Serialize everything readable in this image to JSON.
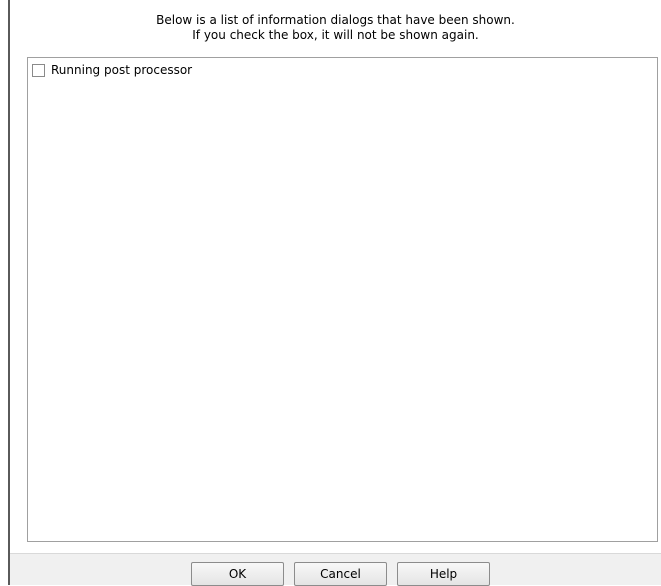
{
  "dialog": {
    "instructions": {
      "line1": "Below is a list of information dialogs that have been shown.",
      "line2": "If you check the box, it will not be shown again."
    },
    "list_items": [
      {
        "label": "Running post processor",
        "checked": false
      }
    ],
    "buttons": {
      "ok_label": "OK",
      "cancel_label": "Cancel",
      "help_label": "Help"
    }
  }
}
